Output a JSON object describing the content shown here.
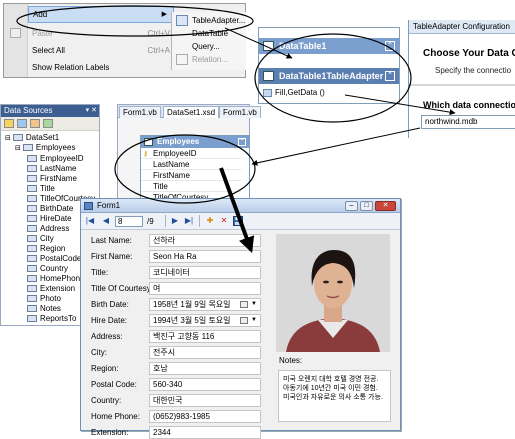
{
  "context_menu": {
    "items": [
      {
        "label": "Add",
        "shortcut": "",
        "state": "selected",
        "submenu": true
      },
      {
        "label": "Paste",
        "shortcut": "Ctrl+V",
        "state": "disabled"
      },
      {
        "label": "Select All",
        "shortcut": "Ctrl+A",
        "state": "normal"
      },
      {
        "label": "Show Relation Labels",
        "shortcut": "",
        "state": "normal"
      }
    ],
    "submenu": [
      {
        "label": "TableAdapter...",
        "state": "normal"
      },
      {
        "label": "DataTable",
        "state": "normal"
      },
      {
        "label": "Query...",
        "state": "normal"
      },
      {
        "label": "Relation...",
        "state": "disabled"
      }
    ]
  },
  "datatable_designer": {
    "table_name": "DataTable1",
    "adapter_name": "DataTable1TableAdapter",
    "method": "Fill,GetData ()"
  },
  "tableadapter_wizard": {
    "title": "TableAdapter Configuration",
    "heading": "Choose Your Data C",
    "subtext": "Specify the connectio",
    "question": "Which data connection",
    "connection_value": "northwind.mdb"
  },
  "data_sources": {
    "title": "Data Sources",
    "window_controls": "▾ ✕",
    "dataset": "DataSet1",
    "table": "Employees",
    "fields": [
      "EmployeeID",
      "LastName",
      "FirstName",
      "Title",
      "TitleOfCourtesy",
      "BirthDate",
      "HireDate",
      "Address",
      "City",
      "Region",
      "PostalCode",
      "Country",
      "HomePhone",
      "Extension",
      "Photo",
      "Notes",
      "ReportsTo"
    ]
  },
  "designer": {
    "tabs": [
      "Form1.vb",
      "DataSet1.xsd",
      "Form1.vb"
    ],
    "active_tab": 1,
    "table_name": "Employees",
    "columns": [
      "EmployeeID",
      "LastName",
      "FirstName",
      "Title",
      "TitleOfCourtesy"
    ]
  },
  "form": {
    "title": "Form1",
    "navigator": {
      "position": "8",
      "count_label": "/9"
    },
    "fields": [
      {
        "label": "Last Name:",
        "value": "선하라",
        "type": "text"
      },
      {
        "label": "First Name:",
        "value": "Seon Ha Ra",
        "type": "text"
      },
      {
        "label": "Title:",
        "value": "코디네이터",
        "type": "text"
      },
      {
        "label": "Title Of Courtesy:",
        "value": "여",
        "type": "text"
      },
      {
        "label": "Birth Date:",
        "value": "1958년  1월  9일 목요일",
        "type": "date"
      },
      {
        "label": "Hire Date:",
        "value": "1994년  3월  5일 토요일",
        "type": "date"
      },
      {
        "label": "Address:",
        "value": "백진구 고향동 116",
        "type": "text"
      },
      {
        "label": "City:",
        "value": "전주시",
        "type": "text"
      },
      {
        "label": "Region:",
        "value": "호남",
        "type": "text"
      },
      {
        "label": "Postal Code:",
        "value": "560-340",
        "type": "text"
      },
      {
        "label": "Country:",
        "value": "대한민국",
        "type": "text"
      },
      {
        "label": "Home Phone:",
        "value": "(0652)983-1985",
        "type": "text"
      },
      {
        "label": "Extension:",
        "value": "2344",
        "type": "text"
      }
    ],
    "notes_label": "Notes:",
    "notes": "미국 오렌지 대학 호텔 경영 전공. 아동기에 10년간 미국 이민 경험. 미국인과 자유로운 의사 소통 가능."
  },
  "colors": {
    "header_blue": "#7a9fcf",
    "header_dark": "#5b7fb0",
    "data_sources_title": "#3c5e91",
    "menu_highlight": "#c9ddf5"
  }
}
